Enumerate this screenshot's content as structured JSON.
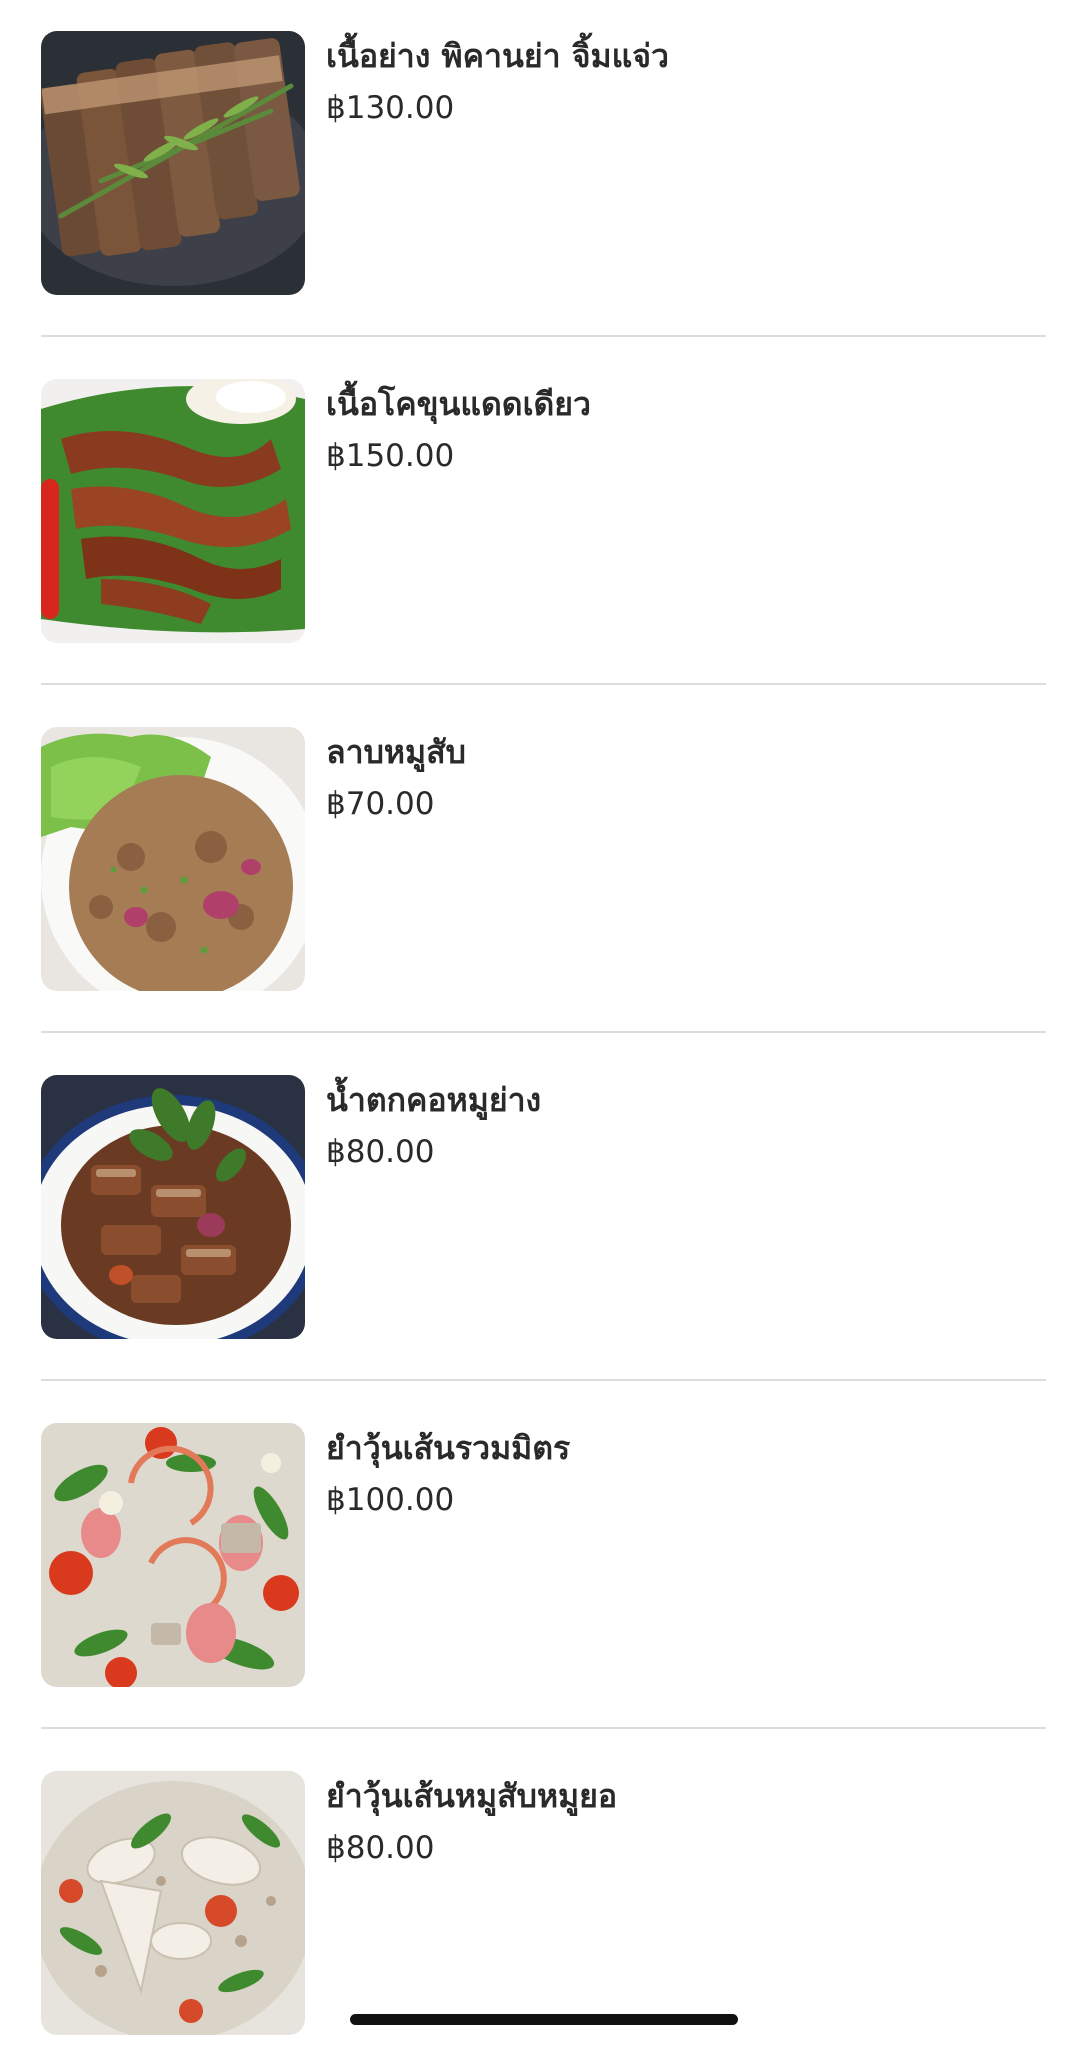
{
  "menu": {
    "currency": "฿",
    "items": [
      {
        "name": "เนื้อย่าง พิคานย่า จิ้มแจ่ว",
        "price": "฿130.00",
        "image": "grilled-beef-image"
      },
      {
        "name": "เนื้อโคขุนแดดเดียว",
        "price": "฿150.00",
        "image": "sun-dried-beef-image"
      },
      {
        "name": "ลาบหมูสับ",
        "price": "฿70.00",
        "image": "minced-pork-larb-image"
      },
      {
        "name": "น้ำตกคอหมูย่าง",
        "price": "฿80.00",
        "image": "grilled-pork-neck-salad-image"
      },
      {
        "name": "ยำวุ้นเส้นรวมมิตร",
        "price": "฿100.00",
        "image": "mixed-glass-noodle-salad-image"
      },
      {
        "name": "ยำวุ้นเส้นหมูสับหมูยอ",
        "price": "฿80.00",
        "image": "pork-sausage-glass-noodle-salad-image"
      }
    ]
  },
  "photo_overlay": {
    "more_label": "···"
  }
}
